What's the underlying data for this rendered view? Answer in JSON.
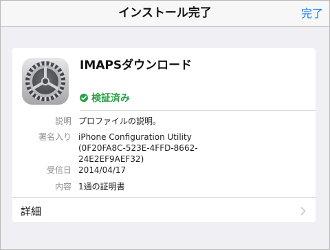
{
  "navbar": {
    "title": "インストール完了",
    "done_label": "完了"
  },
  "profile": {
    "name": "IMAPSダウンロード",
    "icon": "settings-gear-icon",
    "verified_label": "検証済み",
    "verified_color": "#28a146"
  },
  "info": {
    "description": {
      "key": "説明",
      "value": "プロファイルの説明。"
    },
    "signed_by": {
      "key": "署名入り",
      "lines": [
        "iPhone Configuration Utility",
        "(0F20FA8C-523E-4FFD-8662-",
        "24E2EF9AEF32)"
      ]
    },
    "received": {
      "key": "受信日",
      "value": "2014/04/17"
    },
    "contents": {
      "key": "内容",
      "value": "1通の証明書"
    }
  },
  "details": {
    "label": "詳細"
  },
  "colors": {
    "accent": "#1a7cf2",
    "background": "#efeff4"
  }
}
